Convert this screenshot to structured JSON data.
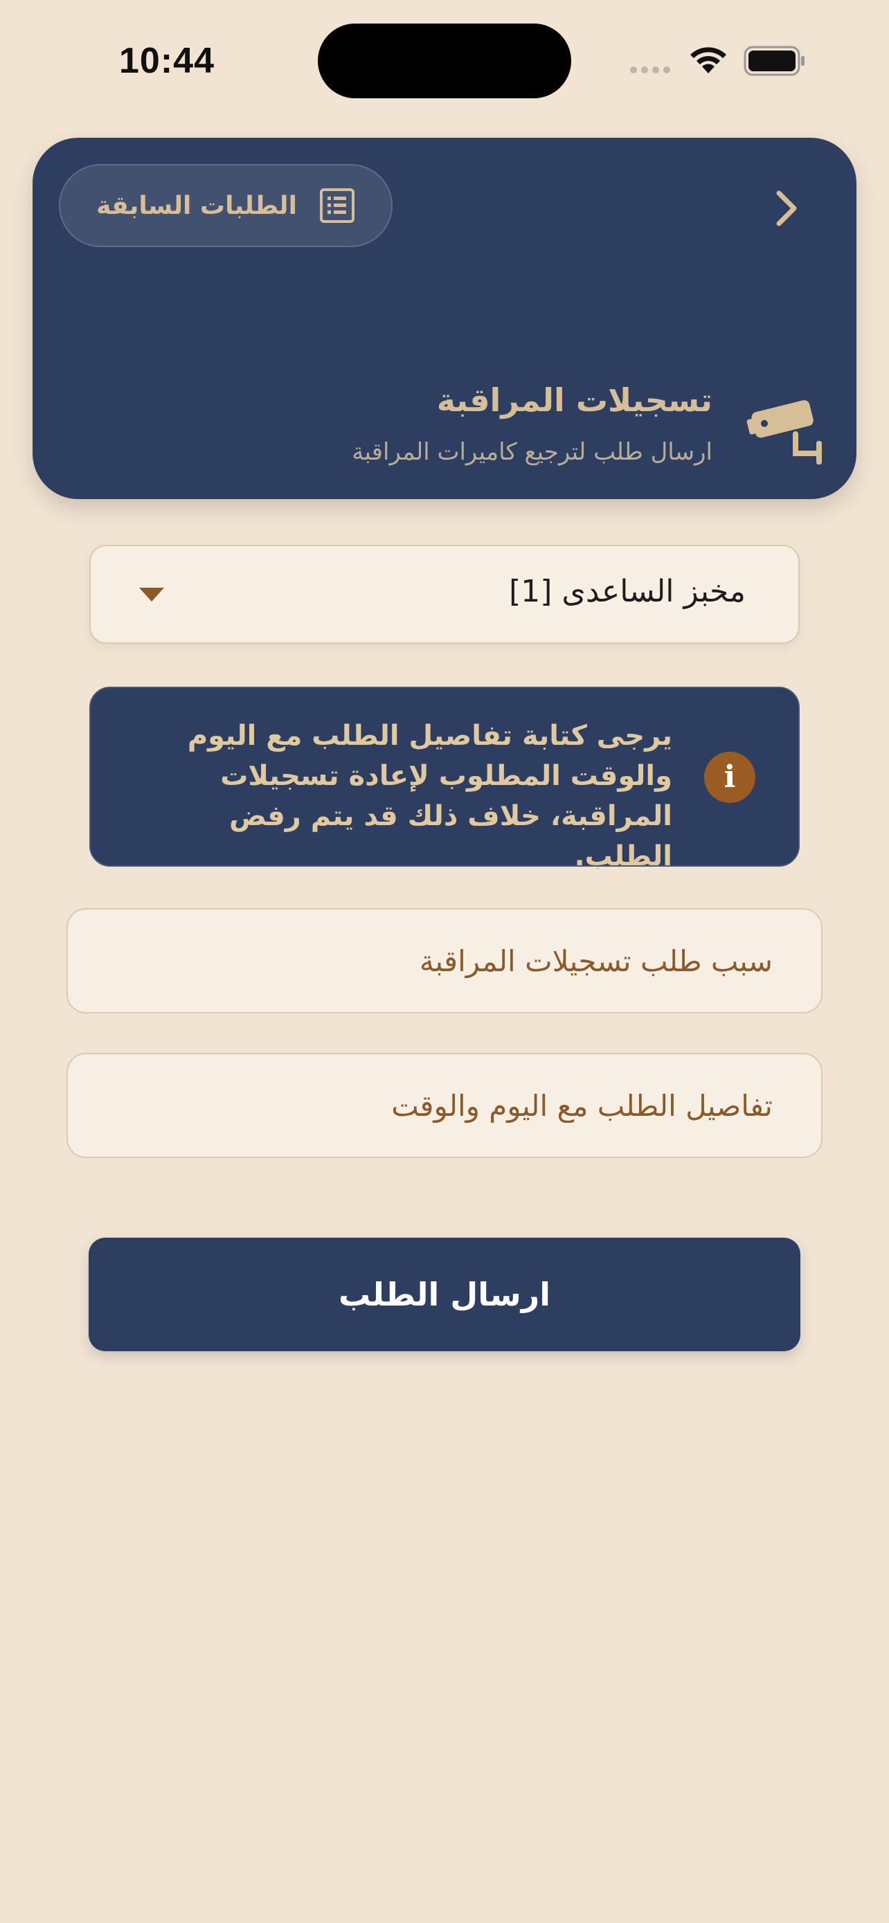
{
  "status_bar": {
    "time": "10:44"
  },
  "header": {
    "previous_requests_label": "الطلبات السابقة",
    "title": "تسجيلات المراقبة",
    "subtitle": "ارسال طلب لترجيع كاميرات المراقبة"
  },
  "branch_select": {
    "selected": "مخبز الساعدى [1]"
  },
  "notice": {
    "text": "يرجى كتابة تفاصيل الطلب مع اليوم والوقت المطلوب لإعادة تسجيلات المراقبة، خلاف ذلك قد يتم رفض الطلب.",
    "icon_glyph": "i"
  },
  "form": {
    "reason_placeholder": "سبب طلب تسجيلات المراقبة",
    "details_placeholder": "تفاصيل الطلب مع اليوم والوقت"
  },
  "submit_label": "ارسال الطلب",
  "colors": {
    "background": "#f2e4d3",
    "navy": "#2e3e60",
    "gold": "#d6bf96",
    "brown": "#8a5a2b",
    "info_icon": "#9a5c22"
  }
}
